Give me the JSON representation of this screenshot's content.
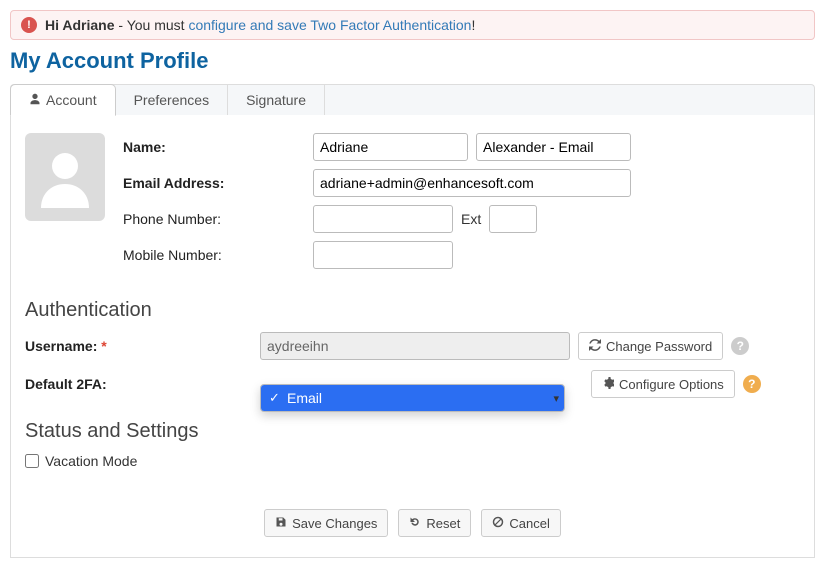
{
  "alert": {
    "greeting": "Hi Adriane",
    "middle": " - You must ",
    "link": "configure and save Two Factor Authentication",
    "end": "!"
  },
  "page_title": "My Account Profile",
  "tabs": {
    "account": "Account",
    "preferences": "Preferences",
    "signature": "Signature"
  },
  "profile": {
    "name_label": "Name:",
    "first_name": "Adriane",
    "last_name": "Alexander - Email",
    "email_label": "Email Address:",
    "email": "adriane+admin@enhancesoft.com",
    "phone_label": "Phone Number:",
    "phone": "",
    "ext_label": "Ext",
    "ext": "",
    "mobile_label": "Mobile Number:",
    "mobile": ""
  },
  "auth": {
    "header": "Authentication",
    "username_label": "Username:",
    "username": "aydreeihn",
    "change_password": "Change Password",
    "default_2fa_label": "Default 2FA:",
    "default_2fa_selected": "Email",
    "configure_options": "Configure Options"
  },
  "status": {
    "header": "Status and Settings",
    "vacation": "Vacation Mode"
  },
  "footer": {
    "save": "Save Changes",
    "reset": "Reset",
    "cancel": "Cancel"
  }
}
